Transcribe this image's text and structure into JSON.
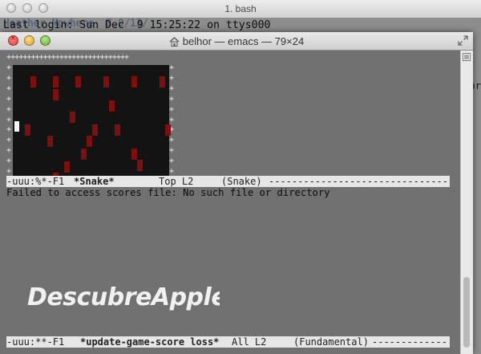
{
  "bash": {
    "title": "1. bash",
    "ghost_text": "Heather Nowhere  8.0/13/",
    "login_text": "Last login: Sun Dec  9 15:25:22 on ttys000",
    "right_glyph": "or"
  },
  "emacs": {
    "title": "belhor — emacs — 79×24",
    "board_top": "++++++++++++++++++++++++++++++",
    "board_left": "+\n+\n+\n+\n+\n+\n+\n+\n+\n+\n+",
    "board_right": "+\n+\n+\n+\n+\n+\n+\n+\n+\n+\n+",
    "modeline_top": {
      "status": "-uuu:%*-F1",
      "buffer": "*Snake*",
      "position": "Top L2",
      "mode": "(Snake)",
      "dashes": "-------------------------------------------"
    },
    "echo": "Failed to access scores file: No such file or directory",
    "modeline_bottom": {
      "status": "-uuu:**-F1",
      "buffer": "*update-game-score loss*",
      "position": "All L2",
      "mode": "(Fundamental)",
      "dashes": "-------------"
    }
  },
  "watermark": "DescubreApple",
  "colors": {
    "snake_red": "#7d0f0f",
    "board_bg": "#131313",
    "text_bg": "#717171"
  }
}
